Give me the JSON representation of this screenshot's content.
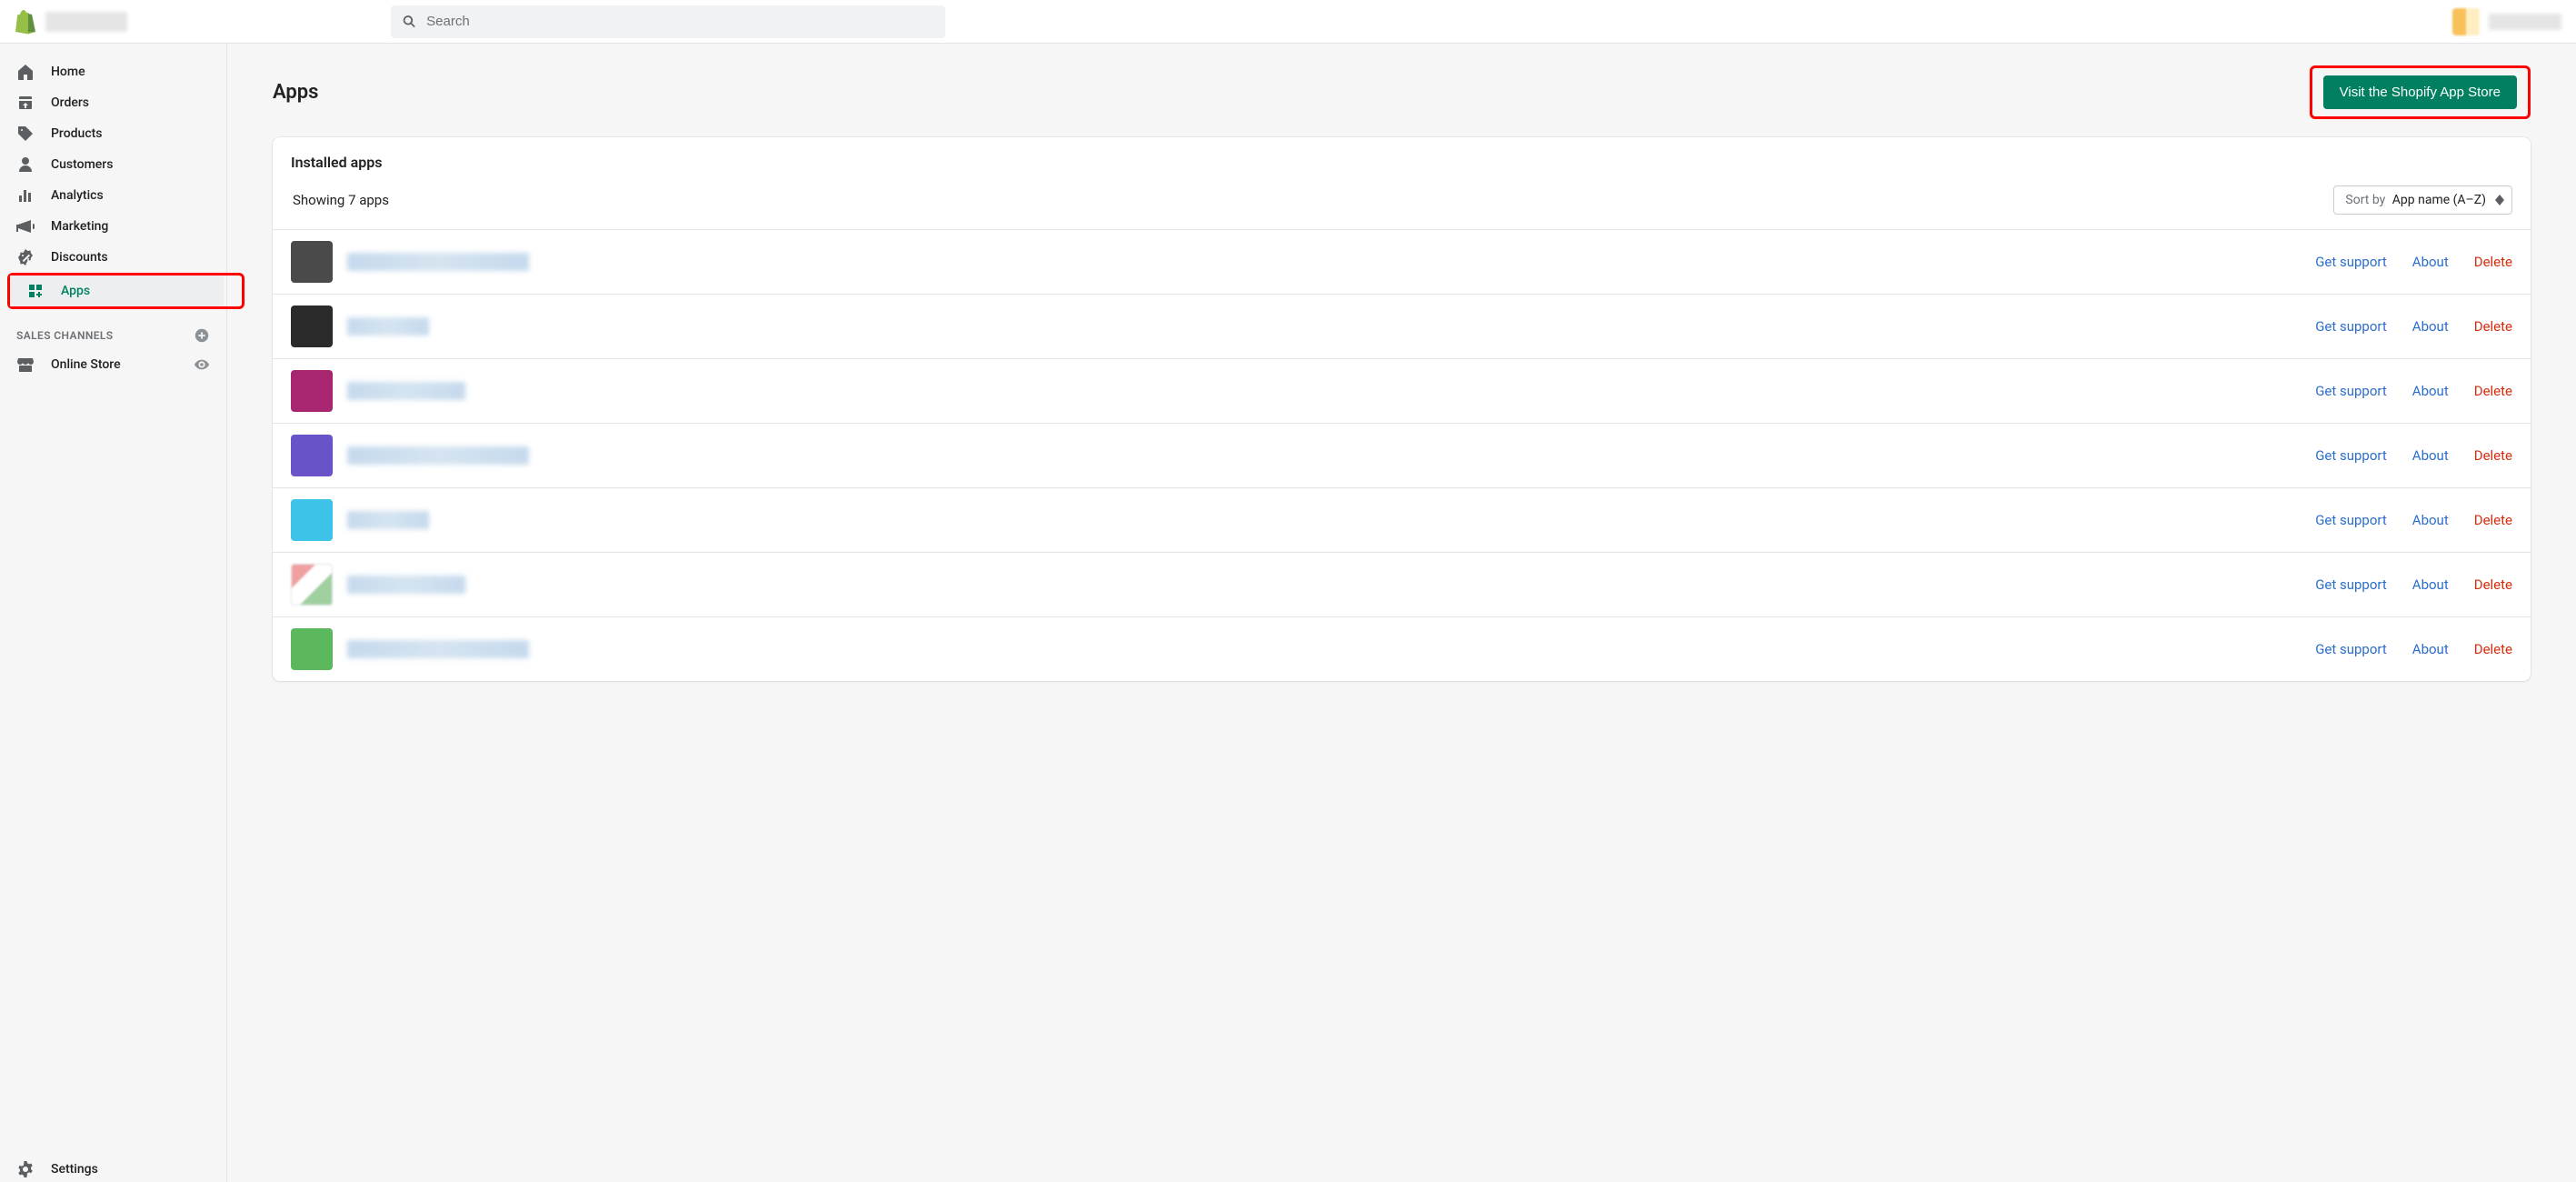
{
  "header": {
    "search_placeholder": "Search"
  },
  "sidebar": {
    "items": [
      {
        "label": "Home",
        "icon": "home"
      },
      {
        "label": "Orders",
        "icon": "orders"
      },
      {
        "label": "Products",
        "icon": "products"
      },
      {
        "label": "Customers",
        "icon": "customers"
      },
      {
        "label": "Analytics",
        "icon": "analytics"
      },
      {
        "label": "Marketing",
        "icon": "marketing"
      },
      {
        "label": "Discounts",
        "icon": "discounts"
      },
      {
        "label": "Apps",
        "icon": "apps",
        "active": true
      }
    ],
    "sales_channels_label": "SALES CHANNELS",
    "channels": [
      {
        "label": "Online Store"
      }
    ],
    "settings_label": "Settings"
  },
  "page": {
    "title": "Apps",
    "visit_button": "Visit the Shopify App Store",
    "installed_apps_title": "Installed apps",
    "showing_text": "Showing 7 apps",
    "sort_by_label": "Sort by",
    "sort_value": "App name (A–Z)",
    "actions": {
      "support": "Get support",
      "about": "About",
      "delete": "Delete"
    },
    "apps": [
      {
        "icon_color": "#4a4a4a",
        "name_width": 200
      },
      {
        "icon_color": "#2b2b2b",
        "name_width": 90
      },
      {
        "icon_color": "#a8256f",
        "name_width": 130
      },
      {
        "icon_color": "#6a52c9",
        "name_width": 200
      },
      {
        "icon_color": "#3ec3e8",
        "name_width": 90
      },
      {
        "icon_color": "#ffffff",
        "name_width": 130
      },
      {
        "icon_color": "#5cb85c",
        "name_width": 200
      }
    ]
  }
}
